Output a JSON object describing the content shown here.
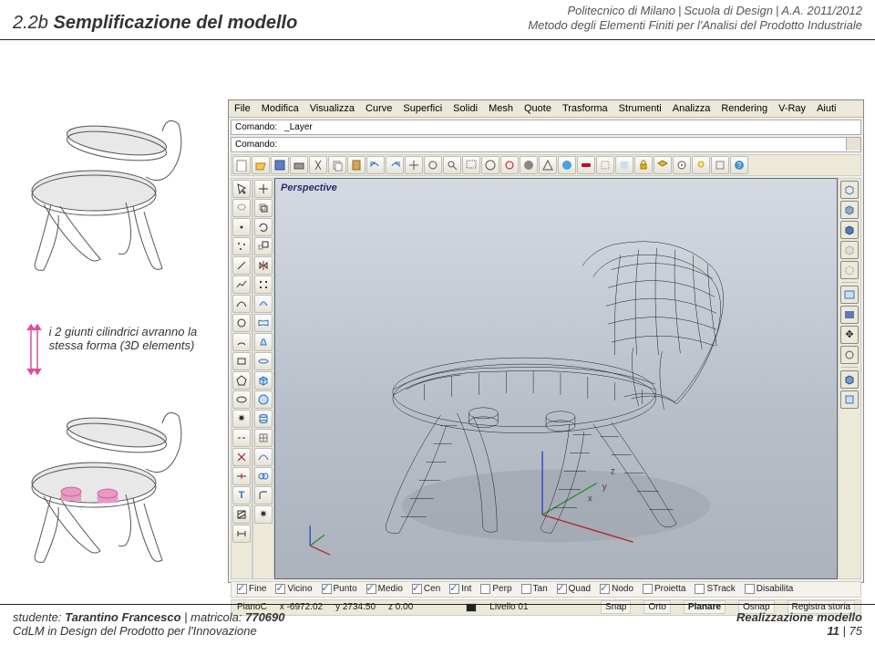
{
  "header": {
    "section_no": "2.2b",
    "section_title": "Semplificazione del modello",
    "inst_a": "Politecnico di Milano",
    "inst_b": "Scuola di Design",
    "inst_c": "A.A. 2011/2012",
    "subtitle": "Metodo degli Elementi Finiti per l'Analisi del Prodotto Industriale"
  },
  "caption": {
    "line1": "i 2 giunti cilindrici avranno la",
    "line2": "stessa forma (3D elements)"
  },
  "rhino": {
    "menu": [
      "File",
      "Modifica",
      "Visualizza",
      "Curve",
      "Superfici",
      "Solidi",
      "Mesh",
      "Quote",
      "Trasforma",
      "Strumenti",
      "Analizza",
      "Rendering",
      "V-Ray",
      "Aiuti"
    ],
    "cmd_label1": "Comando:",
    "cmd_value1": "_Layer",
    "cmd_label2": "Comando:",
    "vp_title": "Perspective",
    "osnaps": [
      {
        "label": "Fine",
        "on": true
      },
      {
        "label": "Vicino",
        "on": true
      },
      {
        "label": "Punto",
        "on": true
      },
      {
        "label": "Medio",
        "on": true
      },
      {
        "label": "Cen",
        "on": true
      },
      {
        "label": "Int",
        "on": true
      },
      {
        "label": "Perp",
        "on": false
      },
      {
        "label": "Tan",
        "on": false
      },
      {
        "label": "Quad",
        "on": true
      },
      {
        "label": "Nodo",
        "on": true
      },
      {
        "label": "Proietta",
        "on": false
      },
      {
        "label": "STrack",
        "on": false
      },
      {
        "label": "Disabilita",
        "on": false
      }
    ],
    "status": {
      "plane": "PianoC",
      "x": "x -6972.02",
      "y": "y 2734.50",
      "z": "z 0.00",
      "layer": "Livello 01",
      "toggles": [
        "Snap",
        "Orto",
        "Planare",
        "Osnap",
        "Registra storia"
      ]
    }
  },
  "footer": {
    "student_lbl": "studente:",
    "student_name": "Tarantino Francesco",
    "mat_lbl": "matricola:",
    "mat_no": "770690",
    "course": "CdLM in Design del Prodotto per l'Innovazione",
    "r_title": "Realizzazione modello",
    "page_cur": "11",
    "page_tot": "75"
  }
}
